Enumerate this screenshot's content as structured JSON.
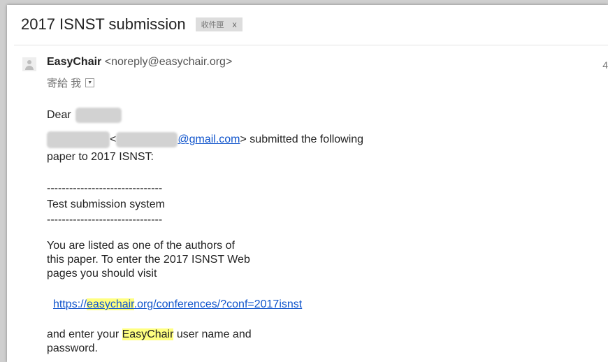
{
  "email": {
    "subject": "2017 ISNST submission",
    "label": "收件匣",
    "label_close": "x",
    "sender_name": "EasyChair",
    "sender_email": "<noreply@easychair.org>",
    "to_text": "寄給 我",
    "greeting": "Dear",
    "body": {
      "open_bracket": "<",
      "email_domain": "@gmail.com",
      "submitted_text": "> submitted the following",
      "line2": "paper to 2017 ISNST:",
      "dashes": "-------------------------------",
      "paper_title": "Test submission system",
      "para1_line1": "You are listed as one of the authors of",
      "para1_line2": "this paper. To enter the 2017 ISNST Web",
      "para1_line3": "pages you should visit",
      "link_prefix": "https://",
      "link_hl": "easychair",
      "link_suffix": ".org/conferences/?conf=2017isnst",
      "para2_prefix": "and enter your ",
      "para2_hl": "EasyChair",
      "para2_suffix": " user name and",
      "para2_line2": "password."
    }
  },
  "colors": {
    "link": "#1155cc",
    "highlight": "#ffff80"
  },
  "icons": {
    "avatar": "avatar-icon",
    "dropdown": "chevron-down-icon"
  }
}
